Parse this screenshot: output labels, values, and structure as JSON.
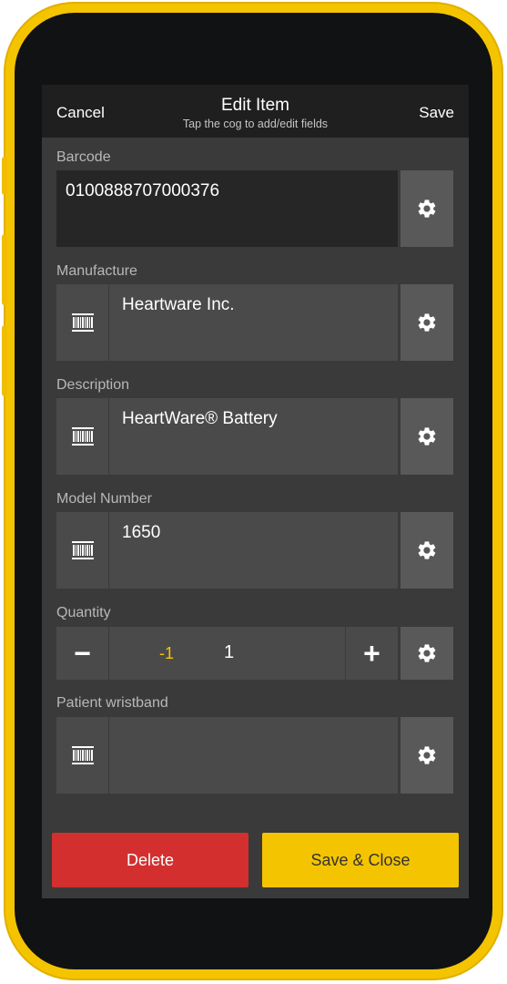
{
  "nav": {
    "cancel_label": "Cancel",
    "title": "Edit Item",
    "subtitle": "Tap the cog to add/edit fields",
    "save_label": "Save"
  },
  "fields": {
    "barcode": {
      "label": "Barcode",
      "value": "0100888707000376"
    },
    "manufacture": {
      "label": "Manufacture",
      "value": "Heartware Inc."
    },
    "description": {
      "label": "Description",
      "value": "HeartWare® Battery"
    },
    "model_number": {
      "label": "Model Number",
      "value": "1650"
    },
    "quantity": {
      "label": "Quantity",
      "decrement_label": "-1",
      "value": "1",
      "minus_symbol": "−",
      "plus_symbol": "+"
    },
    "patient_wristband": {
      "label": "Patient wristband",
      "value": ""
    }
  },
  "actions": {
    "delete_label": "Delete",
    "save_close_label": "Save & Close"
  },
  "icons": {
    "settings": "gear-icon",
    "scan": "barcode-icon"
  },
  "colors": {
    "accent": "#f5c400",
    "danger": "#d32f2f",
    "background": "#3a3a3a",
    "header": "#1f1f1f"
  }
}
